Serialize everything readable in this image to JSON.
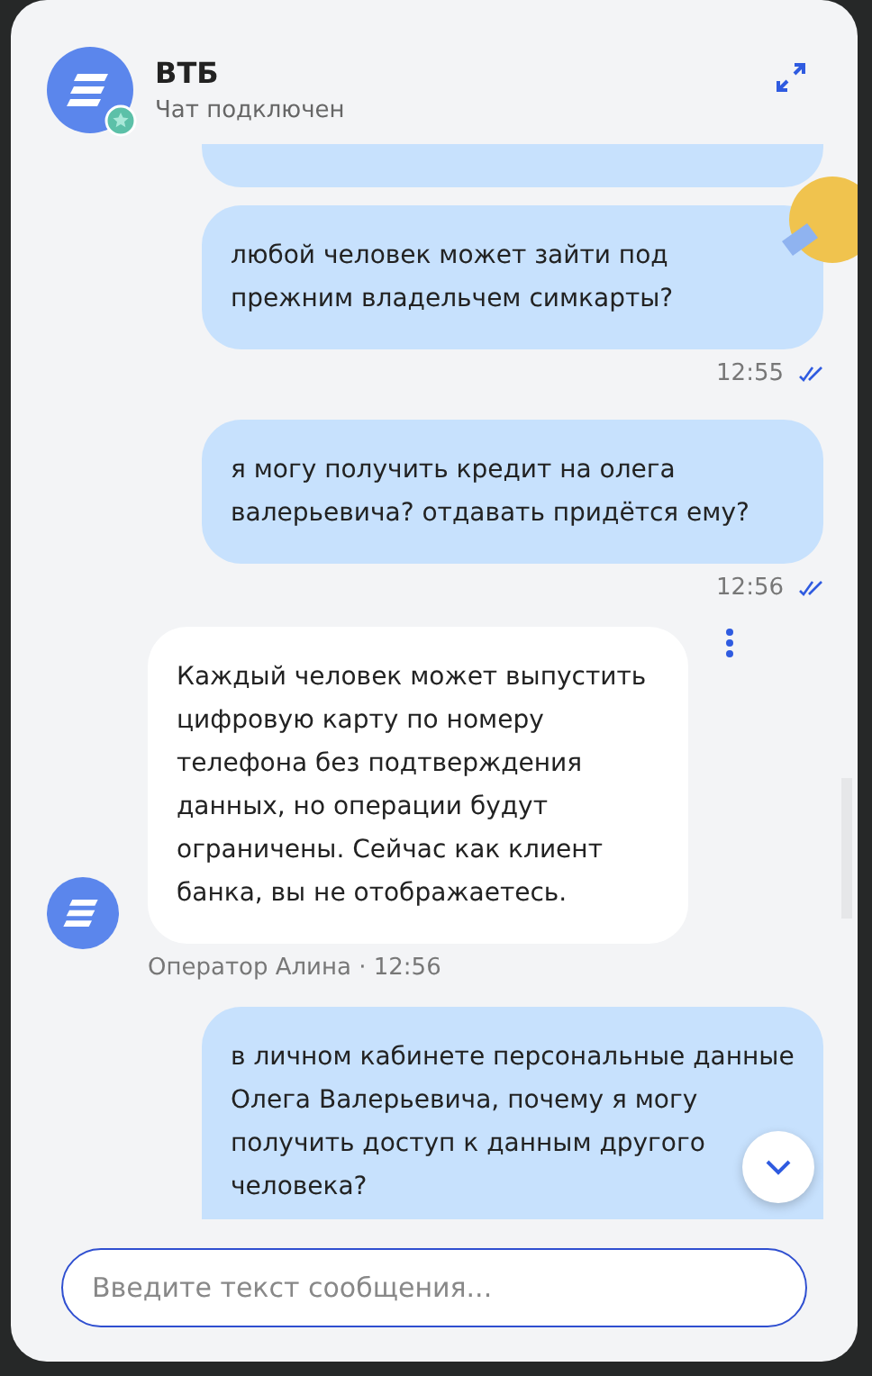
{
  "header": {
    "title": "ВТБ",
    "status": "Чат подключен",
    "online": true
  },
  "messages": [
    {
      "kind": "outgoing",
      "partial": true
    },
    {
      "kind": "outgoing",
      "text": "любой человек может зайти под прежним владельчем симкарты?",
      "time": "12:55",
      "read": true
    },
    {
      "kind": "outgoing",
      "text": "я могу получить кредит на олега валерьевича? отдавать придётся ему?",
      "time": "12:56",
      "read": true
    },
    {
      "kind": "incoming",
      "text": "Каждый человек может выпустить цифровую карту по номеру телефона без подтверждения данных, но операции будут ограничены. Сейчас как клиент банка, вы не отображаетесь.",
      "author": "Оператор Алина · 12:56"
    },
    {
      "kind": "outgoing",
      "text": "в личном кабинете персональные данные Олега Валерьевича, почему я могу получить доступ к данным другого человека?"
    }
  ],
  "composer": {
    "placeholder": "Введите текст сообщения..."
  }
}
